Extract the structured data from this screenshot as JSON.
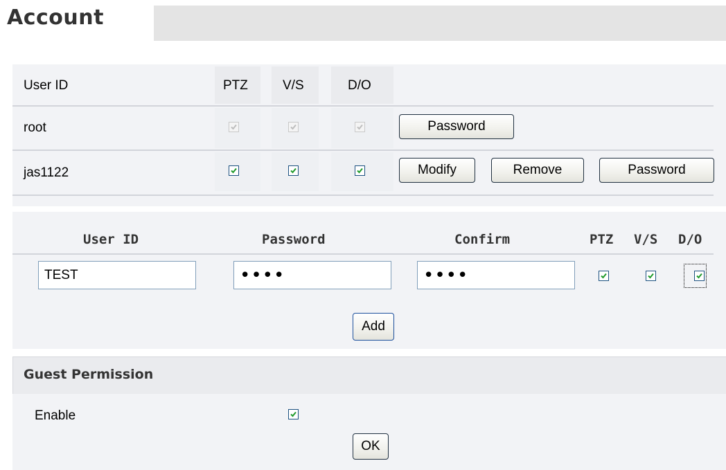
{
  "page": {
    "title": "Account"
  },
  "user_table": {
    "headers": {
      "user_id": "User ID",
      "ptz": "PTZ",
      "vs": "V/S",
      "do": "D/O"
    },
    "rows": [
      {
        "user_id": "root",
        "ptz": true,
        "vs": true,
        "do": true,
        "checkboxes_disabled": true,
        "buttons": [
          "Password"
        ]
      },
      {
        "user_id": "jas1122",
        "ptz": true,
        "vs": true,
        "do": true,
        "checkboxes_disabled": false,
        "buttons": [
          "Modify",
          "Remove",
          "Password"
        ]
      }
    ]
  },
  "add_user": {
    "headers": {
      "user_id": "User ID",
      "password": "Password",
      "confirm": "Confirm",
      "ptz": "PTZ",
      "vs": "V/S",
      "do": "D/O"
    },
    "user_id_value": "TEST",
    "password_value": "••••",
    "confirm_value": "••••",
    "ptz": true,
    "vs": true,
    "do": true,
    "add_label": "Add"
  },
  "guest_permission": {
    "title": "Guest Permission",
    "enable_label": "Enable",
    "enabled": true,
    "ok_label": "OK"
  },
  "colors": {
    "panel_bg": "#f2f3f6",
    "header_bg": "#eaebee",
    "check_green": "#1f9a2a",
    "checkbox_border": "#1c5180"
  }
}
